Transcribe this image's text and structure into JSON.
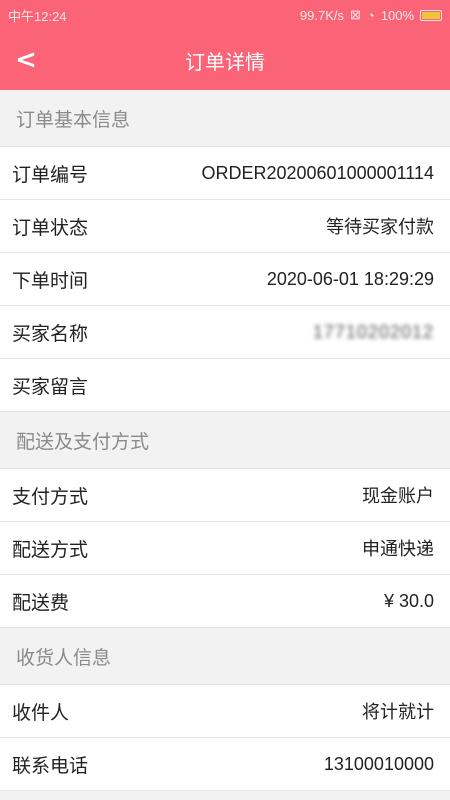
{
  "status": {
    "time": "中午12:24",
    "speed": "99.7K/s",
    "battery": "100%"
  },
  "header": {
    "title": "订单详情"
  },
  "sections": {
    "basic": "订单基本信息",
    "delivery": "配送及支付方式",
    "receiver": "收货人信息"
  },
  "basic": {
    "order_no_label": "订单编号",
    "order_no": "ORDER20200601000001114",
    "status_label": "订单状态",
    "status": "等待买家付款",
    "time_label": "下单时间",
    "time": "2020-06-01 18:29:29",
    "buyer_label": "买家名称",
    "buyer": "17710202012",
    "message_label": "买家留言",
    "message": ""
  },
  "delivery": {
    "pay_label": "支付方式",
    "pay": "现金账户",
    "ship_label": "配送方式",
    "ship": "申通快递",
    "fee_label": "配送费",
    "fee": "¥ 30.0"
  },
  "receiver": {
    "name_label": "收件人",
    "name": "将计就计",
    "phone_label": "联系电话",
    "phone": "13100010000"
  },
  "colors": {
    "accent": "#fb6376"
  }
}
